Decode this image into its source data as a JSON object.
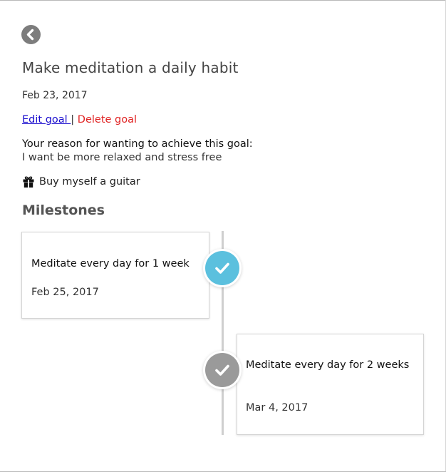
{
  "goal": {
    "title": "Make meditation a daily habit",
    "date": "Feb 23, 2017",
    "edit_label": "Edit goal ",
    "separator": "|",
    "delete_label": "Delete goal",
    "reason_heading": "Your reason for wanting to achieve this goal:",
    "reason_text": "I want be more relaxed and stress free",
    "reward_icon": "gift-icon",
    "reward_text": "Buy myself a guitar"
  },
  "milestones": {
    "heading": "Milestones",
    "items": [
      {
        "title": "Meditate every day for 1 week",
        "date": "Feb 25, 2017",
        "status": "completed",
        "status_color": "#5bc0de"
      },
      {
        "title": "Meditate every day for 2 weeks",
        "date": "Mar 4, 2017",
        "status": "pending",
        "status_color": "#9a9a9a"
      }
    ]
  },
  "icons": {
    "back": "chevron-left-icon",
    "check": "checkmark-icon"
  },
  "colors": {
    "link": "#1a0dce",
    "delete": "#e02424",
    "completed": "#5bc0de",
    "pending": "#9a9a9a"
  }
}
